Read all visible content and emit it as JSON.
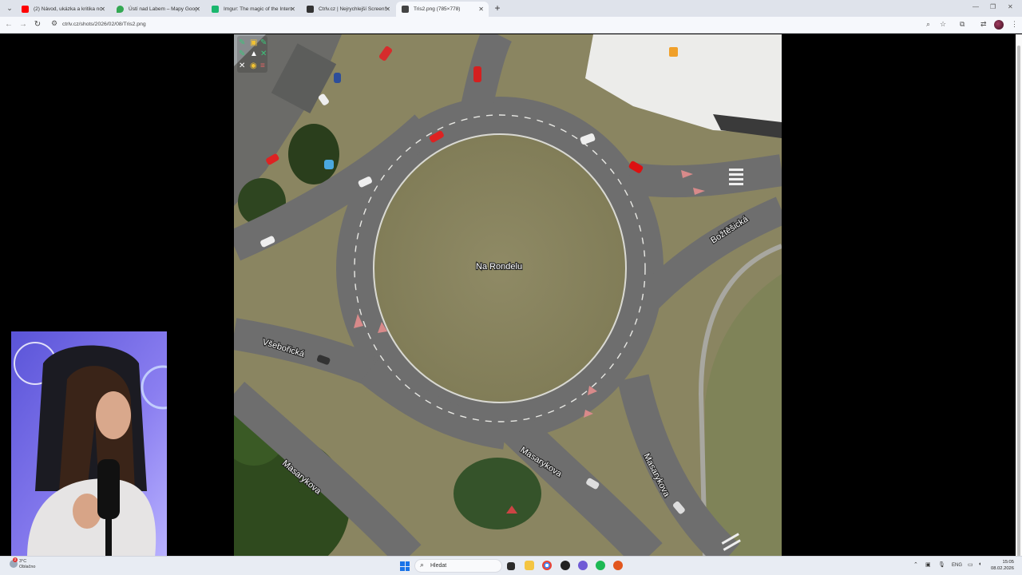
{
  "browser": {
    "tabs": [
      {
        "title": "(2) Návod, ukázka a kritika nove",
        "favicon_color": "#ff0000",
        "active": false
      },
      {
        "title": "Ústí nad Labem – Mapy Google",
        "favicon_color": "#34a853",
        "active": false
      },
      {
        "title": "Imgur: The magic of the Interne",
        "favicon_color": "#1bb76e",
        "active": false
      },
      {
        "title": "Ctrlv.cz | Nejrychlejší ScreenSh",
        "favicon_color": "#333333",
        "active": false
      },
      {
        "title": "Tris2.png (785×778)",
        "favicon_color": "#444444",
        "active": true
      }
    ],
    "url": "ctrlv.cz/shots/2026/02/08/Tris2.png"
  },
  "map": {
    "labels": {
      "roundabout": "Na Rondelu",
      "vseboricka": "Všebořická",
      "bozetisska": "Božtěšická",
      "masarykova_1": "Masarykova",
      "masarykova_2": "Masarykova",
      "masarykova_3": "Masarykova"
    }
  },
  "taskbar": {
    "weather_temp": "3°C",
    "weather_desc": "Oblačno",
    "notification_count": "2",
    "search_placeholder": "Hledat",
    "language": "ENG",
    "time": "15:05",
    "date": "08.02.2026"
  },
  "colors": {
    "grass": "#8a8561",
    "road": "#6e6e6e",
    "tabbar": "#dfe3eb",
    "taskbar": "#e8ecf3",
    "webcam_bg": "#6a5fd6"
  }
}
